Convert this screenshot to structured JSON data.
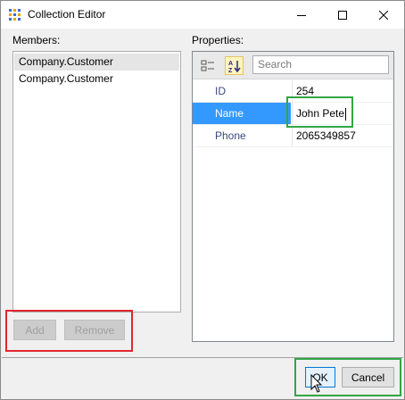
{
  "window": {
    "title": "Collection Editor"
  },
  "members": {
    "label": "Members:",
    "items": [
      {
        "label": "Company.Customer",
        "selected": true
      },
      {
        "label": "Company.Customer",
        "selected": false
      }
    ],
    "add_label": "Add",
    "remove_label": "Remove"
  },
  "properties": {
    "label": "Properties:",
    "search_placeholder": "Search",
    "rows": [
      {
        "name": "ID",
        "value": "254"
      },
      {
        "name": "Name",
        "value": "John Pete"
      },
      {
        "name": "Phone",
        "value": "2065349857"
      }
    ]
  },
  "footer": {
    "ok_label": "OK",
    "cancel_label": "Cancel"
  },
  "colors": {
    "selection": "#3399ff",
    "highlight_red": "#e3262f",
    "highlight_green": "#30a646"
  },
  "icons": [
    "collection-editor-icon",
    "minimize-icon",
    "maximize-icon",
    "close-icon",
    "categorized-icon",
    "alphabetical-sort-icon",
    "mouse-pointer-icon"
  ]
}
